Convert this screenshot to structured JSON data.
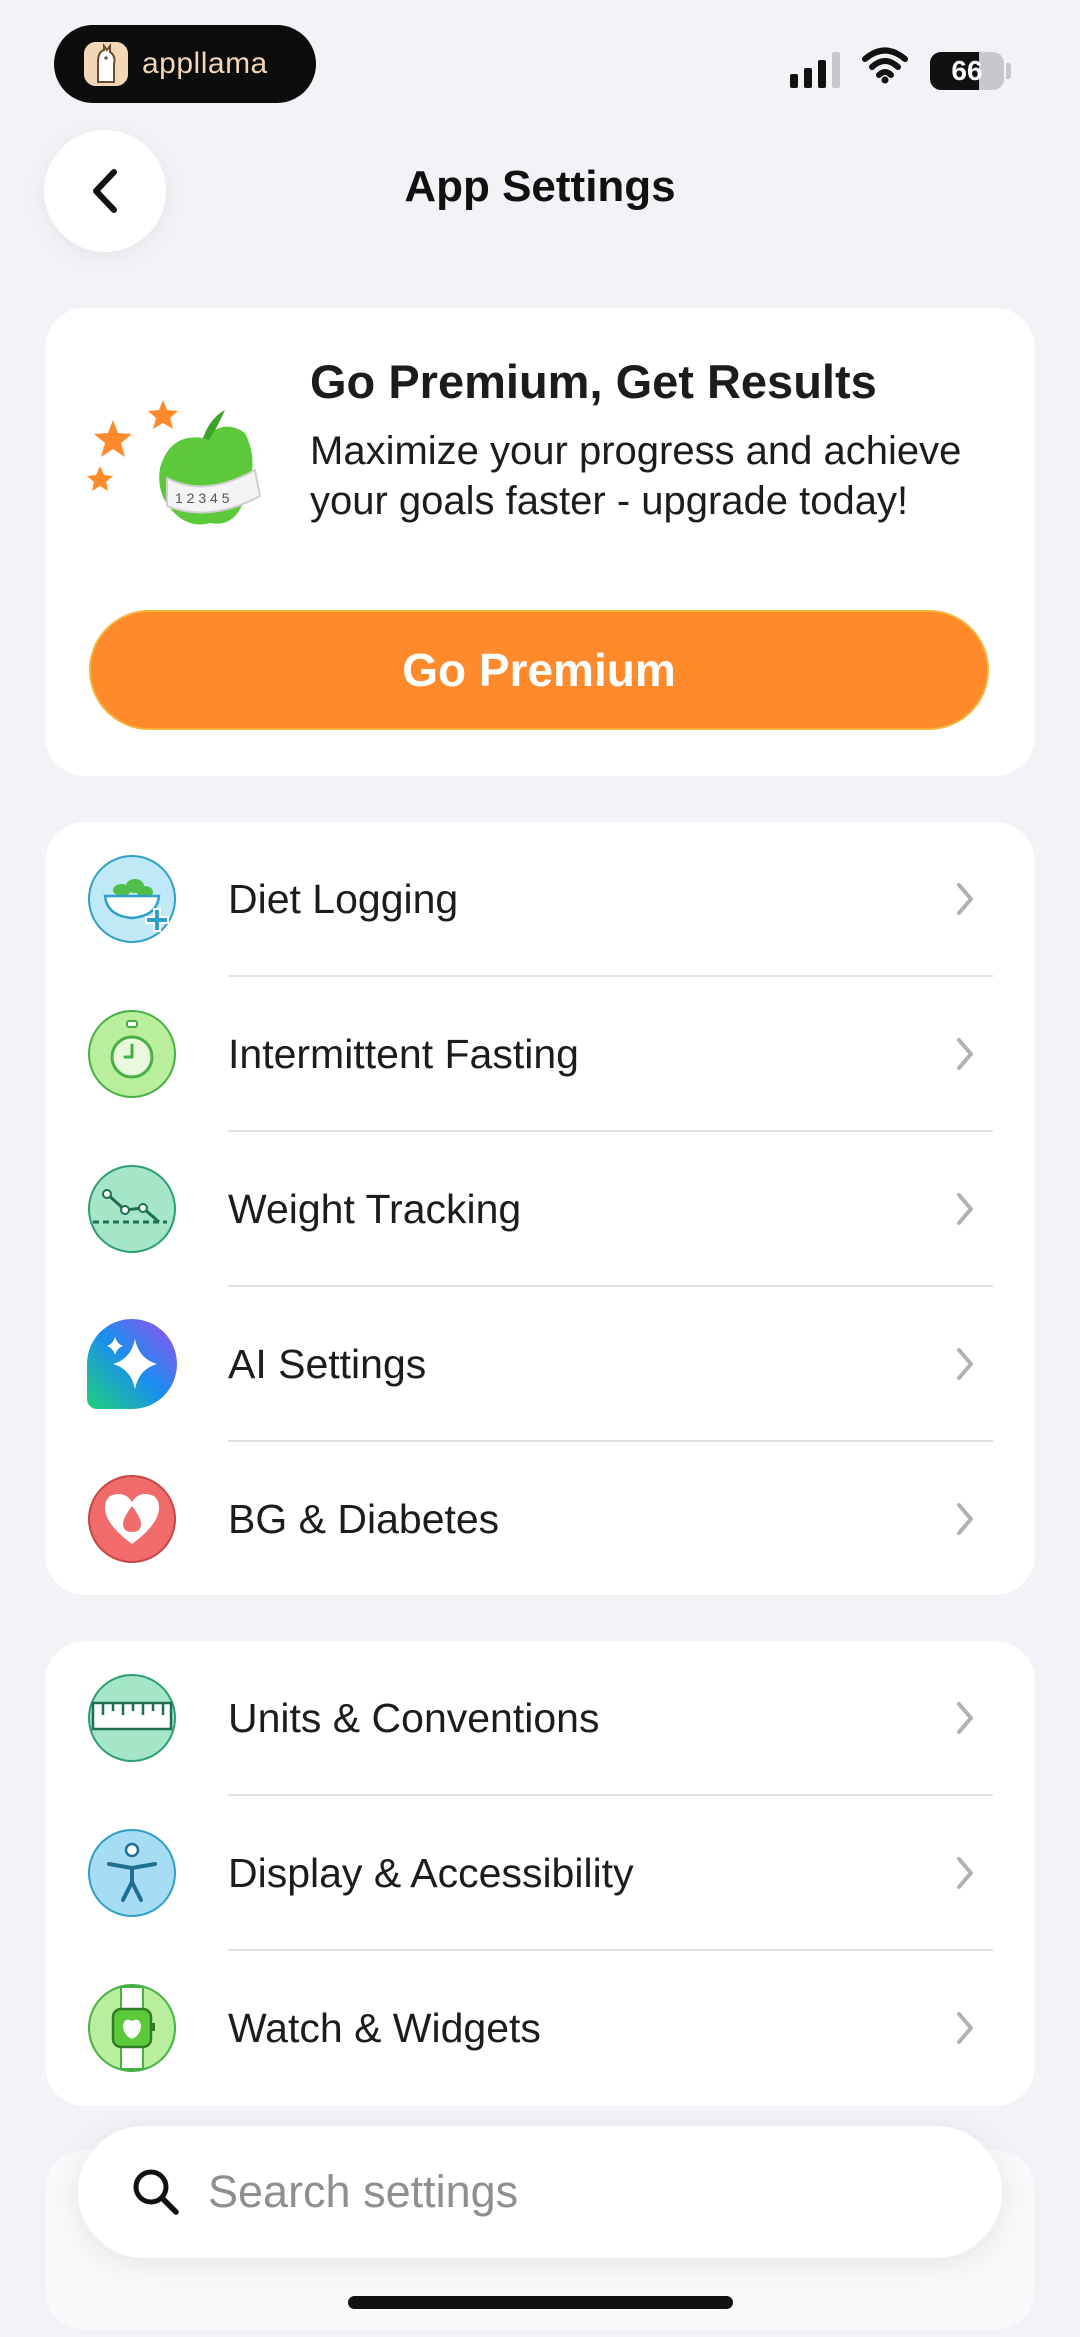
{
  "status_bar": {
    "brand": "appllama",
    "battery": "66",
    "battery_level": 0.66
  },
  "header": {
    "title": "App Settings",
    "back_icon": "chevron-left-icon"
  },
  "premium": {
    "title": "Go Premium, Get Results",
    "description": "Maximize your progress and achieve your goals faster - upgrade today!",
    "button_label": "Go Premium",
    "accent_color": "#ff8a2b"
  },
  "groups": [
    {
      "items": [
        {
          "label": "Diet Logging",
          "icon": "salad-bowl-icon"
        },
        {
          "label": "Intermittent Fasting",
          "icon": "stopwatch-icon"
        },
        {
          "label": "Weight Tracking",
          "icon": "weight-chart-icon"
        },
        {
          "label": "AI Settings",
          "icon": "sparkle-icon"
        },
        {
          "label": "BG & Diabetes",
          "icon": "heart-drop-icon"
        }
      ]
    },
    {
      "items": [
        {
          "label": "Units & Conventions",
          "icon": "ruler-icon"
        },
        {
          "label": "Display & Accessibility",
          "icon": "accessibility-icon"
        },
        {
          "label": "Watch & Widgets",
          "icon": "watch-icon"
        }
      ]
    }
  ],
  "search": {
    "placeholder": "Search settings"
  }
}
